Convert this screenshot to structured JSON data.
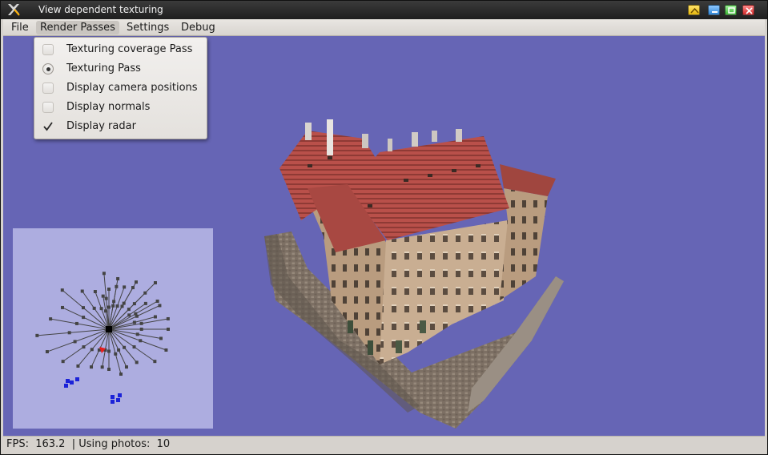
{
  "window": {
    "title": "View dependent texturing"
  },
  "menubar": {
    "file": "File",
    "render_passes": "Render Passes",
    "settings": "Settings",
    "debug": "Debug"
  },
  "render_menu": {
    "items": [
      {
        "label": "Texturing coverage Pass",
        "type": "checkbox",
        "checked": false
      },
      {
        "label": "Texturing Pass",
        "type": "radio",
        "checked": true
      },
      {
        "label": "Display camera positions",
        "type": "checkbox",
        "checked": false
      },
      {
        "label": "Display normals",
        "type": "checkbox",
        "checked": false
      },
      {
        "label": "Display radar",
        "type": "checkbox",
        "checked": true
      }
    ]
  },
  "status": {
    "text": "FPS:  163.2  | Using photos:  10"
  },
  "colors": {
    "viewport_bg": "#6665b5",
    "radar_bg": "#adade0",
    "camera_marker": "#444444",
    "selected_camera": "#1b22d8",
    "current_view": "#e81c1c"
  },
  "icons": {
    "app": "app-logo-icon",
    "shade": "shade-window-icon",
    "minimize": "minimize-icon",
    "maximize": "maximize-icon",
    "close": "close-icon",
    "check": "checkmark-icon"
  }
}
